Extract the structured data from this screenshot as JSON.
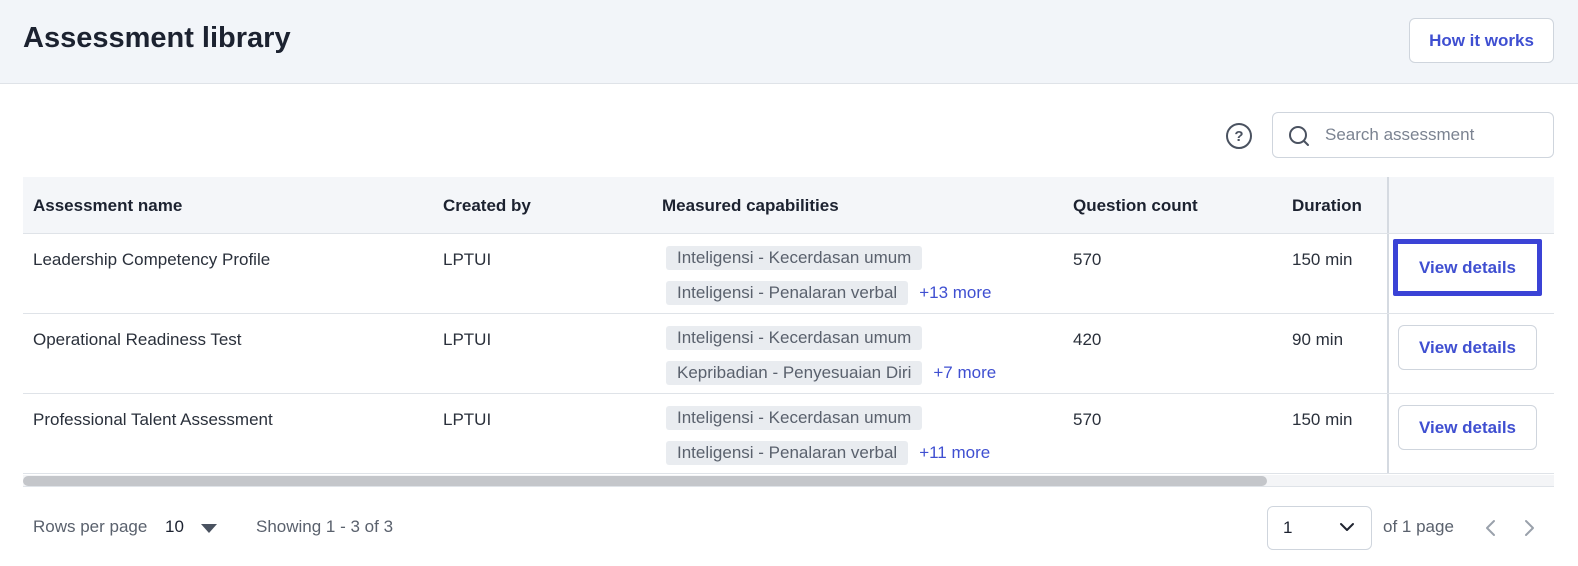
{
  "header": {
    "title": "Assessment library",
    "how_it_works": "How it works"
  },
  "toolbar": {
    "help_icon": "?",
    "search_placeholder": "Search assessment"
  },
  "table": {
    "columns": [
      "Assessment name",
      "Created by",
      "Measured capabilities",
      "Question count",
      "Duration"
    ],
    "rows": [
      {
        "name": "Leadership Competency Profile",
        "created_by": "LPTUI",
        "capabilities": [
          "Inteligensi - Kecerdasan umum",
          "Inteligensi - Penalaran verbal"
        ],
        "more": "+13 more",
        "question_count": "570",
        "duration": "150 min",
        "action": "View details"
      },
      {
        "name": "Operational Readiness Test",
        "created_by": "LPTUI",
        "capabilities": [
          "Inteligensi - Kecerdasan umum",
          "Kepribadian - Penyesuaian Diri"
        ],
        "more": "+7 more",
        "question_count": "420",
        "duration": "90 min",
        "action": "View details"
      },
      {
        "name": "Professional Talent Assessment",
        "created_by": "LPTUI",
        "capabilities": [
          "Inteligensi - Kecerdasan umum",
          "Inteligensi - Penalaran verbal"
        ],
        "more": "+11 more",
        "question_count": "570",
        "duration": "150 min",
        "action": "View details"
      }
    ]
  },
  "footer": {
    "rows_per_page_label": "Rows per page",
    "rows_per_page_value": "10",
    "showing": "Showing 1 - 3 of 3",
    "page_value": "1",
    "of_pages": "of 1 page"
  },
  "icons": [
    "help-icon",
    "search-icon",
    "caret-down-icon",
    "chevron-down-icon",
    "chevron-left-icon",
    "chevron-right-icon"
  ],
  "colors": {
    "accent": "#3f4fd1",
    "focus": "#3b43d6",
    "header_bg": "#f2f5f9"
  }
}
